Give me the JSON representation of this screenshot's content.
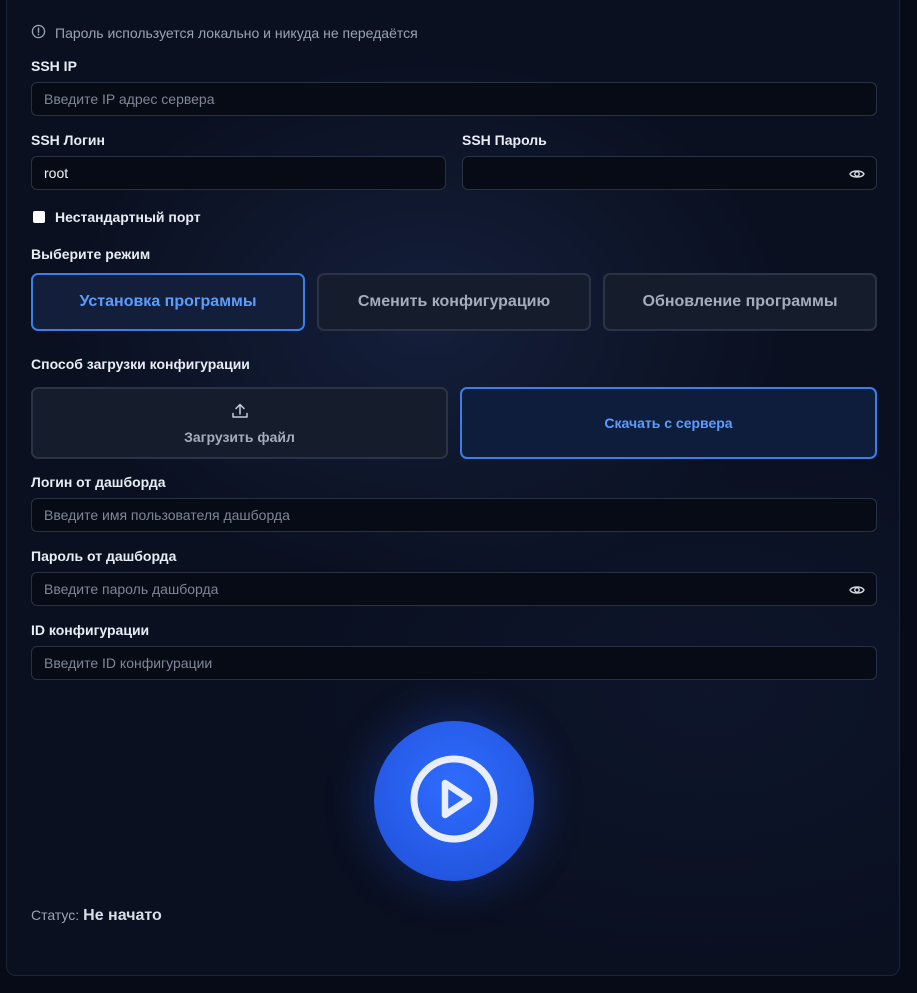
{
  "notice": {
    "text": "Пароль используется локально и никуда не передаётся"
  },
  "ssh": {
    "ip_label": "SSH IP",
    "ip_placeholder": "Введите IP адрес сервера",
    "login_label": "SSH Логин",
    "login_value": "root",
    "password_label": "SSH Пароль",
    "password_value": "",
    "custom_port_label": "Нестандартный порт"
  },
  "mode": {
    "label": "Выберите режим",
    "options": [
      {
        "label": "Установка программы",
        "active": true
      },
      {
        "label": "Сменить конфигурацию",
        "active": false
      },
      {
        "label": "Обновление программы",
        "active": false
      }
    ]
  },
  "config_source": {
    "label": "Способ загрузки конфигурации",
    "options": [
      {
        "label": "Загрузить файл",
        "icon": "upload-icon",
        "active": false
      },
      {
        "label": "Скачать с сервера",
        "active": true
      }
    ]
  },
  "dashboard": {
    "login_label": "Логин от дашборда",
    "login_placeholder": "Введите имя пользователя дашборда",
    "password_label": "Пароль от дашборда",
    "password_placeholder": "Введите пароль дашборда",
    "config_id_label": "ID конфигурации",
    "config_id_placeholder": "Введите ID конфигурации"
  },
  "start": {
    "icon": "play-icon"
  },
  "status": {
    "label": "Статус:",
    "value": "Не начато"
  },
  "colors": {
    "accent": "#3a7ee8",
    "accent_text": "#5c9cff",
    "play_button": "#2559e6",
    "background": "#0a1020"
  }
}
